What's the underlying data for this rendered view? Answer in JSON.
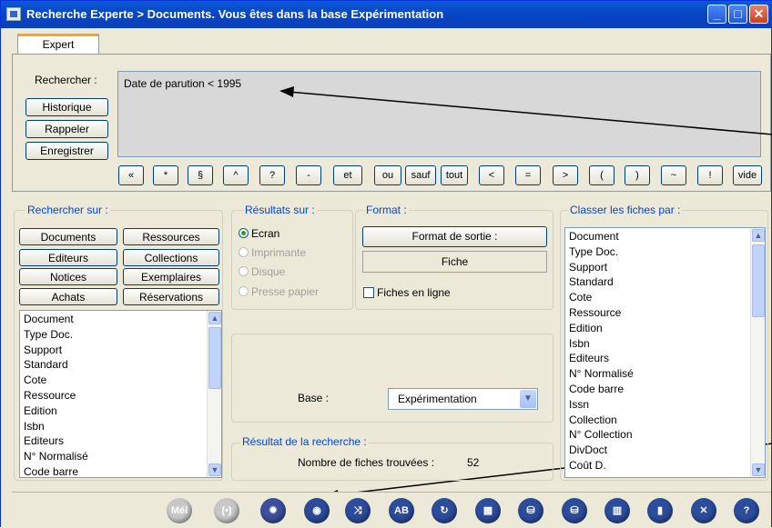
{
  "window": {
    "title": "Recherche Experte > Documents.  Vous êtes dans la base Expérimentation"
  },
  "tabs": [
    "Expert"
  ],
  "search": {
    "label": "Rechercher :",
    "query": "Date de parution < 1995",
    "buttons": [
      "Historique",
      "Rappeler",
      "Enregistrer"
    ]
  },
  "operators": [
    "«",
    "*",
    "§",
    "^",
    "?",
    "-",
    "et",
    "ou",
    "sauf",
    "tout",
    "<",
    "=",
    ">",
    "(",
    ")",
    "~",
    "!",
    "vide"
  ],
  "rechercher_sur": {
    "title": "Rechercher sur :",
    "buttons": [
      "Documents",
      "Ressources",
      "Editeurs",
      "Collections",
      "Notices",
      "Exemplaires",
      "Achats",
      "Réservations"
    ],
    "fields": [
      "Document",
      "Type Doc.",
      "Support",
      "Standard",
      "Cote",
      "Ressource",
      "Edition",
      "Isbn",
      "Editeurs",
      "N° Normalisé",
      "Code barre"
    ]
  },
  "resultats_sur": {
    "title": "Résultats sur :",
    "options": [
      "Ecran",
      "Imprimante",
      "Disque",
      "Presse papier"
    ],
    "selected": "Ecran"
  },
  "format": {
    "title": "Format :",
    "button": "Format de sortie :",
    "value": "Fiche",
    "checkbox": "Fiches en ligne"
  },
  "base": {
    "label": "Base :",
    "value": "Expérimentation"
  },
  "resultat": {
    "title": "Résultat de la recherche :",
    "label": "Nombre de fiches trouvées :",
    "count": "52"
  },
  "classer": {
    "title": "Classer les fiches par :",
    "fields": [
      "Document",
      "Type Doc.",
      "Support",
      "Standard",
      "Cote",
      "Ressource",
      "Edition",
      "Isbn",
      "Editeurs",
      "N° Normalisé",
      "Code barre",
      "Issn",
      "Collection",
      "N° Collection",
      "DivDoct",
      "Coût D."
    ]
  },
  "toolbar": {
    "mel_label": "Mél",
    "icons": [
      "mail-icon",
      "connect-icon",
      "settings-icon",
      "eye-icon",
      "shuffle-icon",
      "spell-check-icon",
      "refresh-icon",
      "grid-icon",
      "basket-icon",
      "basket-add-icon",
      "trash-icon",
      "notebook-icon",
      "close-icon",
      "help-icon"
    ]
  }
}
